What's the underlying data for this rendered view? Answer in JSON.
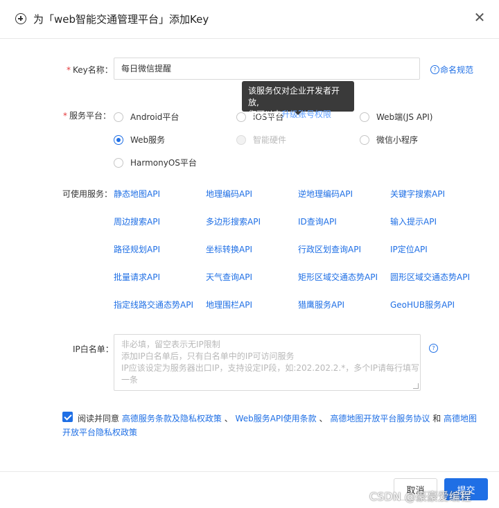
{
  "dialog": {
    "title": "为「web智能交通管理平台」添加Key"
  },
  "key_name": {
    "label": "Key名称：",
    "required_mark": "*",
    "value": "每日微信提醒",
    "naming_link": "命名规范"
  },
  "tooltip": {
    "line1": "该服务仅对企业开发者开放,",
    "line2_prefix": "您可以去",
    "line2_link": "升级账号权限"
  },
  "platform": {
    "label": "服务平台：",
    "required_mark": "*",
    "options": [
      {
        "label": "Android平台",
        "checked": false,
        "disabled": false
      },
      {
        "label": "iOS平台",
        "checked": false,
        "disabled": false
      },
      {
        "label": "Web端(JS API)",
        "checked": false,
        "disabled": false
      },
      {
        "label": "Web服务",
        "checked": true,
        "disabled": false
      },
      {
        "label": "智能硬件",
        "checked": false,
        "disabled": true
      },
      {
        "label": "微信小程序",
        "checked": false,
        "disabled": false
      },
      {
        "label": "HarmonyOS平台",
        "checked": false,
        "disabled": false
      }
    ]
  },
  "services": {
    "label": "可使用服务：",
    "items": [
      "静态地图API",
      "地理编码API",
      "逆地理编码API",
      "关键字搜索API",
      "周边搜索API",
      "多边形搜索API",
      "ID查询API",
      "输入提示API",
      "路径规划API",
      "坐标转换API",
      "行政区划查询API",
      "IP定位API",
      "批量请求API",
      "天气查询API",
      "矩形区域交通态势API",
      "圆形区域交通态势API",
      "指定线路交通态势API",
      "地理围栏API",
      "猎鹰服务API",
      "GeoHUB服务API"
    ]
  },
  "ip_whitelist": {
    "label": "IP白名单：",
    "placeholder_lines": [
      "非必填，留空表示无IP限制",
      "添加IP白名单后，只有白名单中的IP可访问服务",
      "IP应该设定为服务器出口IP，支持设定IP段，如:202.202.2.*，多个IP请每行填写",
      "一条"
    ]
  },
  "agreement": {
    "prefix": "阅读并同意",
    "link1": "高德服务条款及隐私权政策",
    "sep1": "、",
    "link2": "Web服务API使用条款",
    "sep2": "、",
    "link3": "高德地图开放平台服务协议",
    "and": "和",
    "link4": "高德地图开放平台隐私权政策",
    "checked": true
  },
  "footer": {
    "cancel_label": "取消",
    "submit_label": "提交"
  },
  "watermark": "CSDN @豪豪爱编程",
  "colors": {
    "accent": "#1f6fe5",
    "required": "#e4393c",
    "tooltip_bg": "#3a3a3a"
  }
}
